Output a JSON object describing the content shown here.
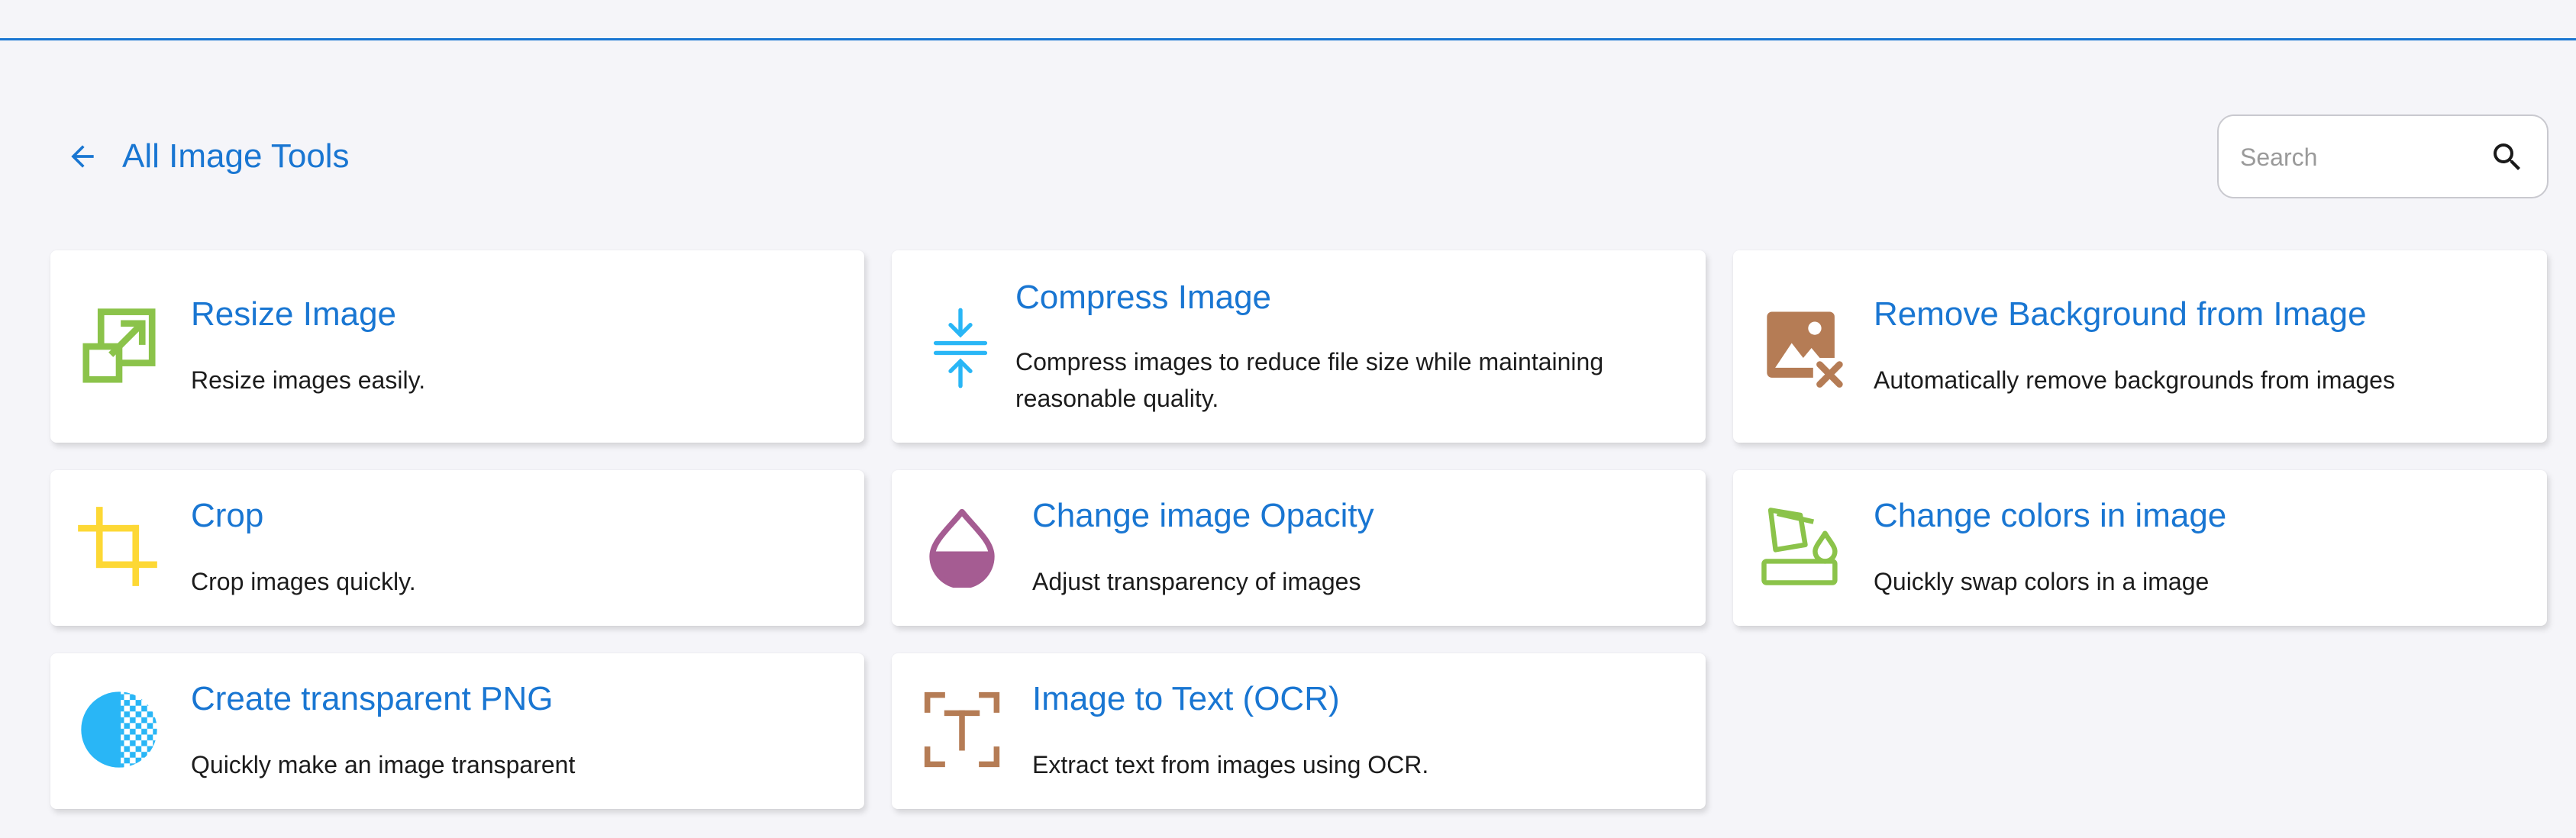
{
  "header": {
    "back_label": "Back",
    "title": "All Image Tools"
  },
  "search": {
    "placeholder": "Search",
    "value": ""
  },
  "colors": {
    "accent": "#1976d2",
    "green": "#8bc34a",
    "yellow": "#fdd835",
    "cyan": "#29b6f6",
    "purple": "#a55c92",
    "brown": "#b57c55",
    "background": "#f5f5f9"
  },
  "tools": [
    {
      "title": "Resize Image",
      "description": "Resize images easily.",
      "icon": "resize-icon"
    },
    {
      "title": "Compress Image",
      "description": "Compress images to reduce file size while maintaining reasonable quality.",
      "icon": "compress-icon"
    },
    {
      "title": "Remove Background from Image",
      "description": "Automatically remove backgrounds from images",
      "icon": "remove-background-icon"
    },
    {
      "title": "Crop",
      "description": "Crop images quickly.",
      "icon": "crop-icon"
    },
    {
      "title": "Change image Opacity",
      "description": "Adjust transparency of images",
      "icon": "opacity-icon"
    },
    {
      "title": "Change colors in image",
      "description": "Quickly swap colors in a image",
      "icon": "color-swap-icon"
    },
    {
      "title": "Create transparent PNG",
      "description": "Quickly make an image transparent",
      "icon": "transparent-png-icon"
    },
    {
      "title": "Image to Text (OCR)",
      "description": "Extract text from images using OCR.",
      "icon": "ocr-icon"
    }
  ]
}
